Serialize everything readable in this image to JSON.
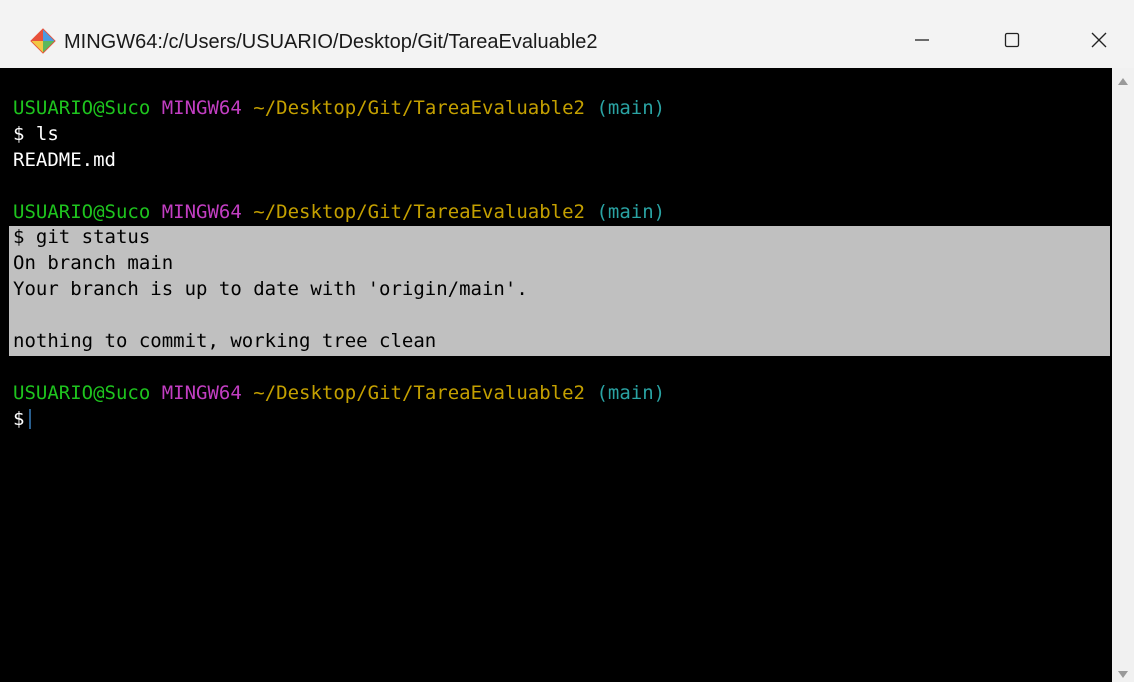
{
  "window": {
    "title": "MINGW64:/c/Users/USUARIO/Desktop/Git/TareaEvaluable2",
    "icon": "git-bash-icon",
    "controls": {
      "minimize_icon": "minimize-icon",
      "maximize_icon": "maximize-icon",
      "close_icon": "close-icon"
    }
  },
  "colors": {
    "user": "#1ec41e",
    "host": "#c23ec2",
    "path": "#c4a000",
    "branch": "#2aa3a3",
    "selection": "#c0c0c0"
  },
  "terminal": {
    "prompts": [
      {
        "user": "USUARIO@Suco",
        "host": "MINGW64",
        "path": "~/Desktop/Git/TareaEvaluable2",
        "branch": "(main)"
      },
      {
        "user": "USUARIO@Suco",
        "host": "MINGW64",
        "path": "~/Desktop/Git/TareaEvaluable2",
        "branch": "(main)"
      },
      {
        "user": "USUARIO@Suco",
        "host": "MINGW64",
        "path": "~/Desktop/Git/TareaEvaluable2",
        "branch": "(main)"
      }
    ],
    "commands": [
      "$ ls",
      "$ git status",
      "$"
    ],
    "ls_output": "README.md",
    "status_output": [
      "On branch main",
      "Your branch is up to date with 'origin/main'.",
      "",
      "nothing to commit, working tree clean"
    ]
  }
}
